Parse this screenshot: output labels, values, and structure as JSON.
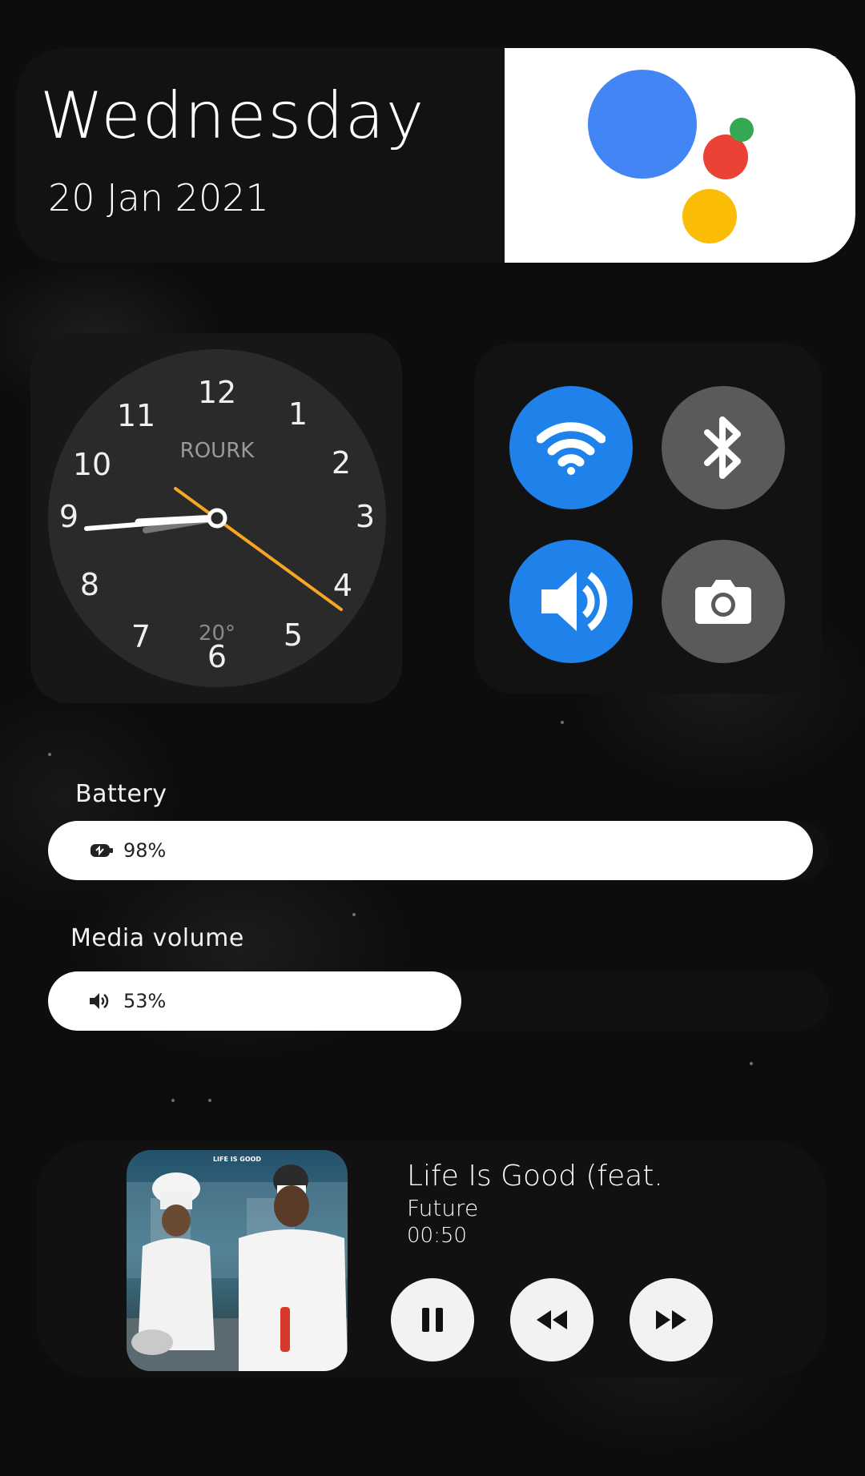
{
  "date_widget": {
    "day": "Wednesday",
    "date": "20 Jan 2021",
    "assistant_icon": "google-assistant-icon",
    "assistant_colors": [
      "#4285f4",
      "#ea4335",
      "#fbbc05",
      "#34a853"
    ]
  },
  "clock": {
    "numbers": [
      "12",
      "1",
      "2",
      "3",
      "4",
      "5",
      "6",
      "7",
      "8",
      "9",
      "10",
      "11"
    ],
    "brand": "ROURK",
    "temperature": "20°",
    "time_shown": "8:50:22",
    "second_hand_color": "#f6a623"
  },
  "toggles": [
    {
      "name": "wifi",
      "icon": "wifi-icon",
      "state": "on"
    },
    {
      "name": "bluetooth",
      "icon": "bluetooth-icon",
      "state": "off"
    },
    {
      "name": "sound",
      "icon": "speaker-icon",
      "state": "on"
    },
    {
      "name": "camera",
      "icon": "camera-icon",
      "state": "off"
    }
  ],
  "colors": {
    "accent": "#1e82ea",
    "toggle_off": "#5a5a5a"
  },
  "battery": {
    "label": "Battery",
    "value_text": "98%",
    "level": 0.98,
    "icon": "battery-icon"
  },
  "media_volume": {
    "label": "Media volume",
    "value_text": "53%",
    "level": 0.53,
    "icon": "volume-icon"
  },
  "media": {
    "title": "Life Is Good (feat.",
    "artist": "Future",
    "time": "00:50",
    "album_art_text": "LIFE IS GOOD",
    "controls": [
      {
        "name": "pause",
        "icon": "pause-icon"
      },
      {
        "name": "rewind",
        "icon": "rewind-icon"
      },
      {
        "name": "fast-forward",
        "icon": "fast-forward-icon"
      }
    ]
  }
}
